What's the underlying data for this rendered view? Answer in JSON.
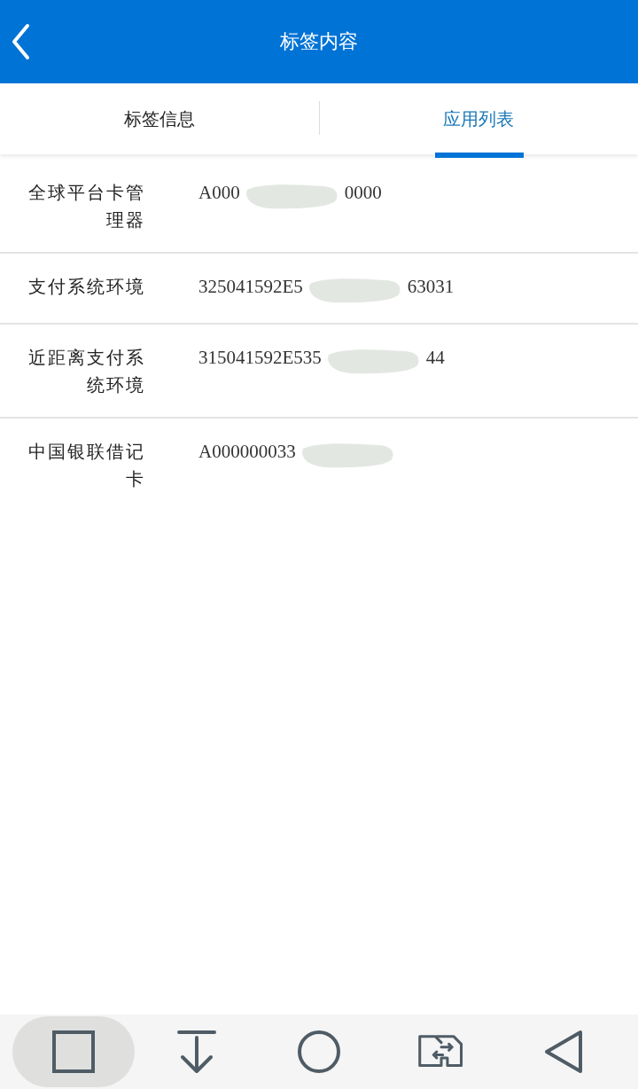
{
  "header": {
    "title": "标签内容"
  },
  "tabs": [
    {
      "label": "标签信息",
      "selected": false
    },
    {
      "label": "应用列表",
      "selected": true
    }
  ],
  "rows": [
    {
      "name": "全球平台卡管理器",
      "value_parts": [
        "A000",
        "0000"
      ]
    },
    {
      "name": "支付系统环境",
      "value_parts": [
        "325041592E5",
        "63031"
      ]
    },
    {
      "name": "近距离支付系统环境",
      "value_parts": [
        "315041592E535",
        "44"
      ]
    },
    {
      "name": "中国银联借记卡",
      "value_parts": [
        "A000000033"
      ]
    }
  ],
  "nav_bar": [
    {
      "kind": "recents",
      "selected": true
    },
    {
      "kind": "download",
      "selected": false
    },
    {
      "kind": "home",
      "selected": false
    },
    {
      "kind": "switch",
      "selected": false
    },
    {
      "kind": "back",
      "selected": false
    }
  ]
}
